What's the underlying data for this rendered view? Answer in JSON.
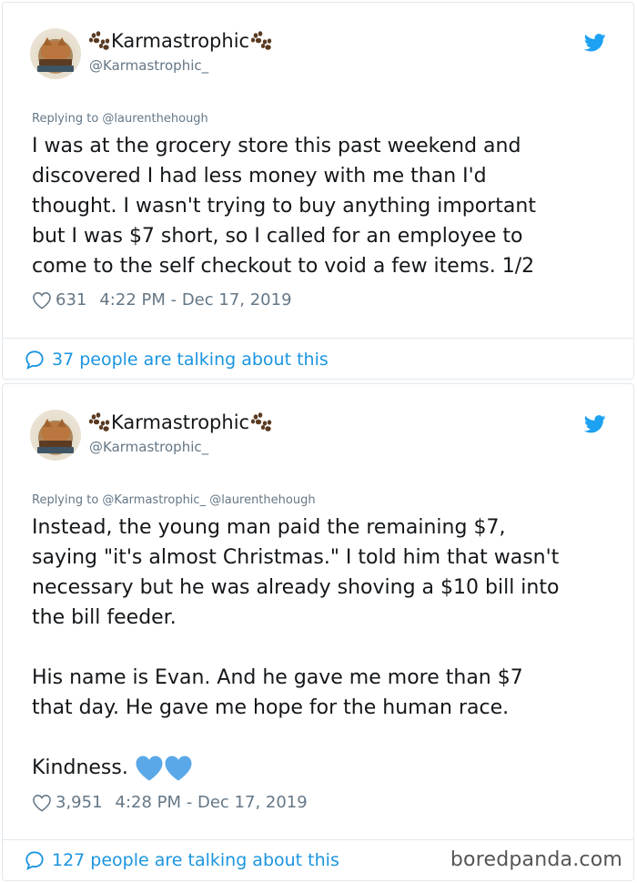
{
  "colors": {
    "text": "#14171a",
    "secondary": "#657786",
    "link": "#1b95e0",
    "border": "#e1e8ed",
    "heart_emoji": "#5aa8e8"
  },
  "icons": {
    "paw": "paw-prints-emoji",
    "bird": "twitter-bird-icon",
    "like": "heart-outline-icon",
    "reply": "speech-bubble-icon",
    "emoji_hearts": "blue-heart-emoji"
  },
  "tweets": [
    {
      "display_name": "Karmastrophic",
      "handle": "@Karmastrophic_",
      "replying_to": "Replying to @laurenthehough",
      "text": "I was at the grocery store this past weekend and\ndiscovered I had less money with me than I'd\nthought. I wasn't trying to buy anything important\nbut I was $7 short, so I called for an employee to\ncome to the self checkout to void a few items. 1/2",
      "likes": "631",
      "timestamp": "4:22 PM - Dec 17, 2019",
      "talking": "37 people are talking about this"
    },
    {
      "display_name": "Karmastrophic",
      "handle": "@Karmastrophic_",
      "replying_to": "Replying to @Karmastrophic_ @laurenthehough",
      "text": "Instead, the young man paid the remaining $7,\nsaying \"it's almost Christmas.\" I told him that wasn't\nnecessary but he was already shoving a $10 bill into\nthe bill feeder.\n\nHis name is Evan. And he gave me more than $7\nthat day. He gave me hope for the human race.\n\n",
      "text_last": "Kindness.",
      "likes": "3,951",
      "timestamp": "4:28 PM - Dec 17, 2019",
      "talking": "127 people are talking about this"
    }
  ],
  "watermark": "boredpanda.com"
}
